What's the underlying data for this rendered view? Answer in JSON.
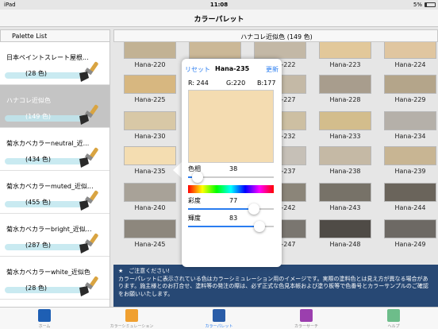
{
  "status": {
    "carrier": "iPad",
    "time": "11:08",
    "battery": "5%"
  },
  "nav": {
    "title": "カラーパレット"
  },
  "left": {
    "header": "Palette List",
    "items": [
      {
        "name": "日本ペイントスレート屋根...",
        "count": "(28 色)"
      },
      {
        "name": "ハナコレ近似色",
        "count": "(149 色)"
      },
      {
        "name": "菊水カベカラーneutral_近...",
        "count": "(434 色)"
      },
      {
        "name": "菊水カベカラーmuted_近似...",
        "count": "(455 色)"
      },
      {
        "name": "菊水カベカラーbright_近似...",
        "count": "(287 色)"
      },
      {
        "name": "菊水カベカラーwhite_近似色",
        "count": "(28 色)"
      }
    ]
  },
  "right": {
    "header": "ハナコレ近似色 (149 色)",
    "rows": [
      [
        {
          "label": "Hana-220",
          "color": "#c2b294"
        },
        {
          "label": "Hana-221",
          "color": "#cbb897"
        },
        {
          "label": "Hana-222",
          "color": "#c3b8a6"
        },
        {
          "label": "Hana-223",
          "color": "#e2c89a"
        },
        {
          "label": "Hana-224",
          "color": "#e0c6a0"
        }
      ],
      [
        {
          "label": "Hana-225",
          "color": "#d7b780"
        },
        {
          "label": "",
          "color": ""
        },
        {
          "label": "Hana-227",
          "color": "#c4b9a6"
        },
        {
          "label": "Hana-228",
          "color": "#a89d8d"
        },
        {
          "label": "Hana-229",
          "color": "#b4a58a"
        }
      ],
      [
        {
          "label": "Hana-230",
          "color": "#d8c8a6"
        },
        {
          "label": "",
          "color": ""
        },
        {
          "label": "Hana-232",
          "color": "#cdbfa2"
        },
        {
          "label": "Hana-233",
          "color": "#d3bd8c"
        },
        {
          "label": "Hana-234",
          "color": "#b5b0a9"
        }
      ],
      [
        {
          "label": "Hana-235",
          "color": "#f4ddb1"
        },
        {
          "label": "",
          "color": ""
        },
        {
          "label": "Hana-237",
          "color": "#c6c0b7"
        },
        {
          "label": "Hana-238",
          "color": "#c5b9a5"
        },
        {
          "label": "Hana-239",
          "color": "#c8b593"
        }
      ],
      [
        {
          "label": "Hana-240",
          "color": "#a8a298"
        },
        {
          "label": "",
          "color": ""
        },
        {
          "label": "Hana-242",
          "color": "#8b8579"
        },
        {
          "label": "Hana-243",
          "color": "#777268"
        },
        {
          "label": "Hana-244",
          "color": "#6a645b"
        }
      ],
      [
        {
          "label": "Hana-245",
          "color": "#8d877d"
        },
        {
          "label": "",
          "color": ""
        },
        {
          "label": "Hana-247",
          "color": "#7a7670"
        },
        {
          "label": "Hana-248",
          "color": "#4f4b46"
        },
        {
          "label": "Hana-249",
          "color": "#6d6964"
        }
      ]
    ]
  },
  "popover": {
    "reset": "リセット",
    "title": "Hana-235",
    "update": "更新",
    "r": "R:  244",
    "g": "G:220",
    "b": "B:177",
    "swatch_color": "#f4dcb1",
    "hue_label": "色相",
    "hue_value": "38",
    "hue_level": 0.11,
    "saturation_label": "彩度",
    "saturation_value": "77",
    "saturation_level": 0.77,
    "brightness_label": "輝度",
    "brightness_value": "83",
    "brightness_level": 0.83
  },
  "notice": {
    "title": "★　ご注意ください!",
    "body": "カラーパレットに表示されている色はカラーシミュレーション用のイメージです。実際の塗料色とは見え方が異なる場合があります。施主様とのお打合せ、塗料等の発注の際は、必ず正式な色見本帳および塗り板等で色番号とカラーサンプルのご確認をお願いいたします。"
  },
  "tabs": [
    {
      "label": "ホーム",
      "icon": "top-icon",
      "color": "#1e5fb4"
    },
    {
      "label": "カラーシミュレーション",
      "icon": "house-icon",
      "color": "#f0a030"
    },
    {
      "label": "カラーパレット",
      "icon": "palette-icon",
      "color": "#2a5da8"
    },
    {
      "label": "カラーサーチ",
      "icon": "search-icon",
      "color": "#9b3fae"
    },
    {
      "label": "ヘルプ",
      "icon": "help-icon",
      "color": "#6dbd8a"
    }
  ]
}
